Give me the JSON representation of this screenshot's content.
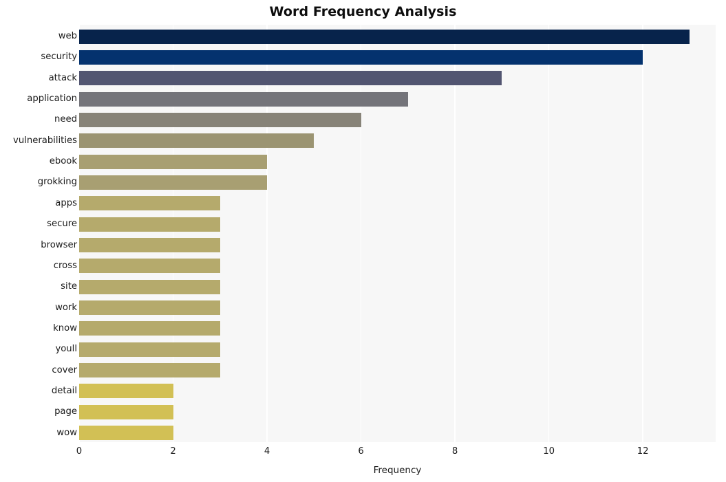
{
  "chart_data": {
    "type": "bar",
    "orientation": "horizontal",
    "title": "Word Frequency Analysis",
    "xlabel": "Frequency",
    "ylabel": "",
    "categories": [
      "web",
      "security",
      "attack",
      "application",
      "need",
      "vulnerabilities",
      "ebook",
      "grokking",
      "apps",
      "secure",
      "browser",
      "cross",
      "site",
      "work",
      "know",
      "youll",
      "cover",
      "detail",
      "page",
      "wow"
    ],
    "values": [
      13,
      12,
      9,
      7,
      6,
      5,
      4,
      4,
      3,
      3,
      3,
      3,
      3,
      3,
      3,
      3,
      3,
      2,
      2,
      2
    ],
    "bar_colors": [
      "#07234b",
      "#04326e",
      "#525571",
      "#74747a",
      "#878378",
      "#9b9472",
      "#a89f72",
      "#a89f72",
      "#b5aa6c",
      "#b5aa6c",
      "#b5aa6c",
      "#b5aa6c",
      "#b5aa6c",
      "#b5aa6c",
      "#b5aa6c",
      "#b5aa6c",
      "#b5aa6c",
      "#d2c055",
      "#d2c055",
      "#d2c055"
    ],
    "xlim": [
      0,
      13.55
    ],
    "xticks": [
      0,
      2,
      4,
      6,
      8,
      10,
      12
    ],
    "xtick_labels": [
      "0",
      "2",
      "4",
      "6",
      "8",
      "10",
      "12"
    ],
    "grid": "vertical",
    "legend": "none",
    "plot_background": "#f7f7f7",
    "gridline_color": "#ffffff",
    "figure_background": "#ffffff",
    "title_color": "#0d0d0d",
    "tick_label_color": "#1a1a1a"
  }
}
